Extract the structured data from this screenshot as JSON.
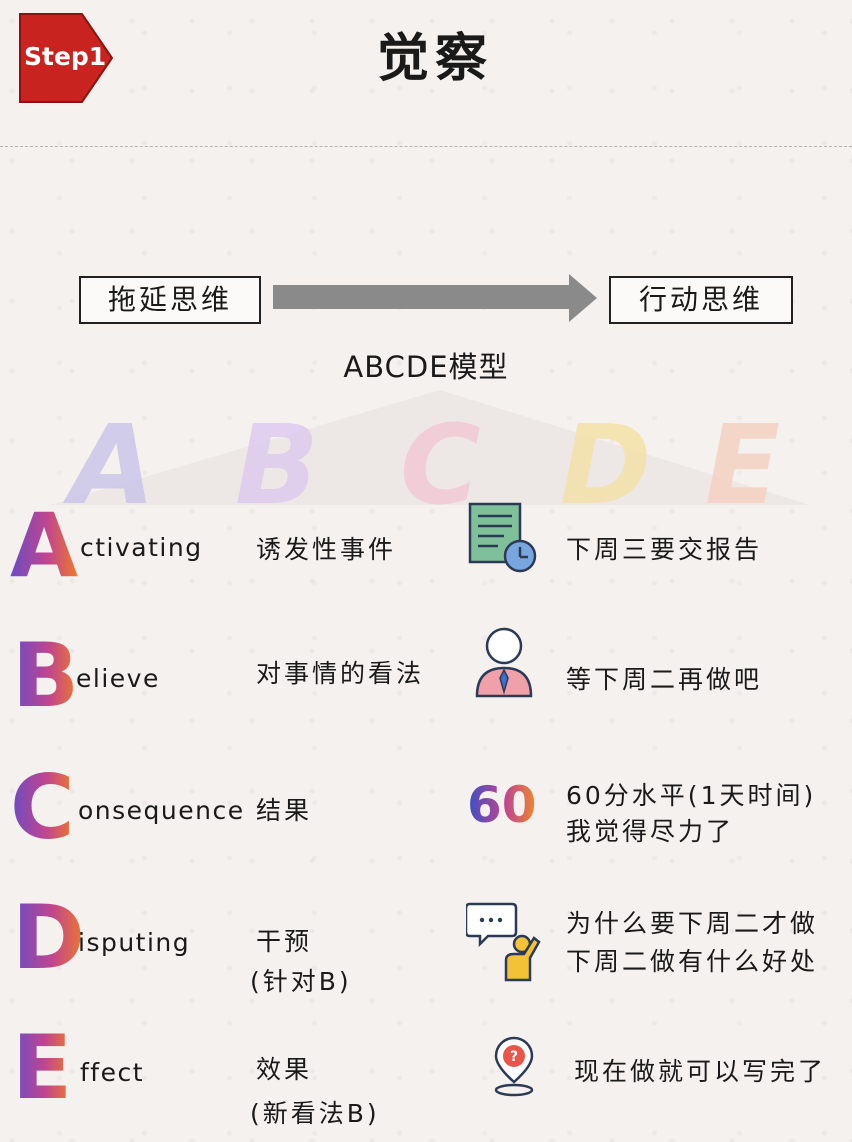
{
  "header": {
    "step_label": "Step1",
    "title": "觉察"
  },
  "flow": {
    "from": "拖延思维",
    "to": "行动思维"
  },
  "model_title": "ABCDE模型",
  "watermark_letters": [
    "A",
    "B",
    "C",
    "D",
    "E"
  ],
  "rows": [
    {
      "letter": "A",
      "rest": "ctivating",
      "meaning": [
        "诱发性事件"
      ],
      "icon": "report-clock-icon",
      "example": [
        "下周三要交报告"
      ]
    },
    {
      "letter": "B",
      "rest": "elieve",
      "meaning": [
        "对事情的看法"
      ],
      "icon": "person-icon",
      "example": [
        "等下周二再做吧"
      ]
    },
    {
      "letter": "C",
      "rest": "onsequence",
      "meaning": [
        "结果"
      ],
      "icon_text": "60",
      "example": [
        "60分水平(1天时间)",
        "我觉得尽力了"
      ]
    },
    {
      "letter": "D",
      "rest": "isputing",
      "meaning": [
        "干预",
        "(针对B)"
      ],
      "icon": "speech-bubble-person-icon",
      "example": [
        "为什么要下周二才做",
        "下周二做有什么好处"
      ]
    },
    {
      "letter": "E",
      "rest": "ffect",
      "meaning": [
        "效果",
        "(新看法B)"
      ],
      "icon": "question-location-icon",
      "example": [
        "现在做就可以写完了"
      ]
    }
  ],
  "colors": {
    "badge": "#c8231e",
    "gradient_start": "#6a4cc4",
    "gradient_mid": "#c0458f",
    "gradient_end": "#f07a2a"
  }
}
